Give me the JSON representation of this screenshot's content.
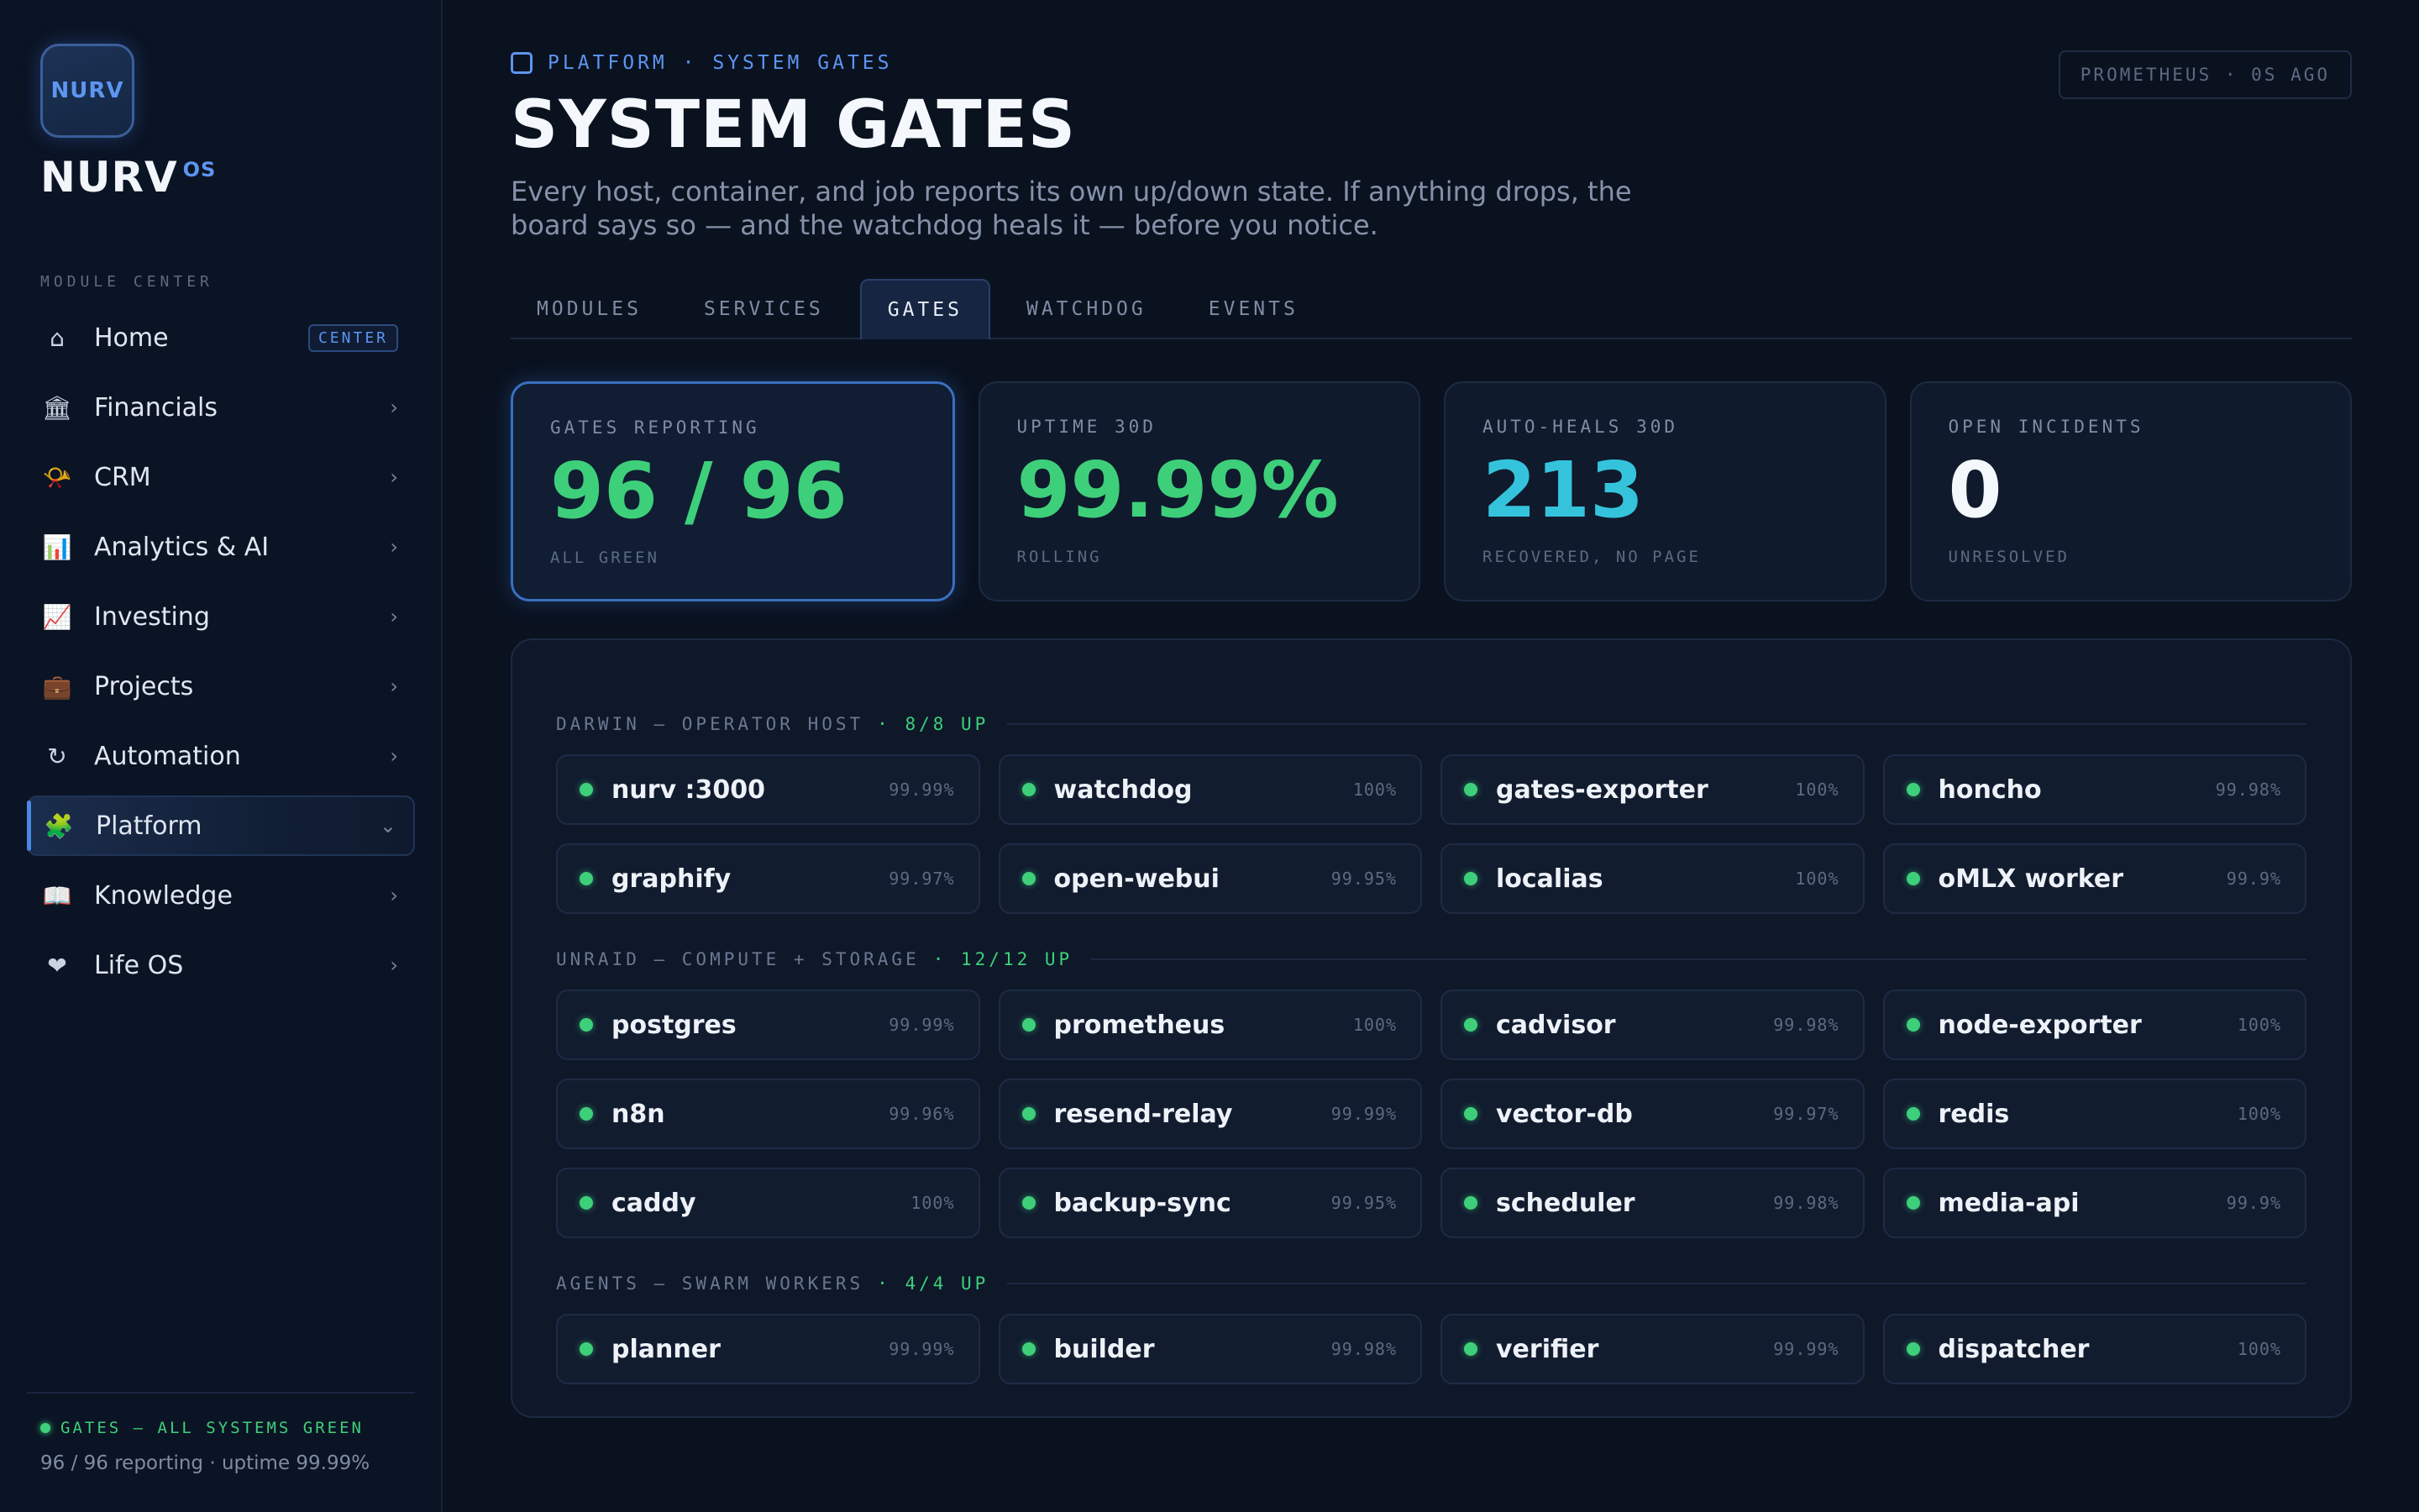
{
  "sidebar": {
    "logo_text": "NURV",
    "brand": "NURV",
    "brand_sup": "OS",
    "section_label": "MODULE CENTER",
    "items": [
      {
        "label": "Home",
        "icon": "⌂",
        "badge": "CENTER"
      },
      {
        "label": "Financials",
        "icon": "🏛",
        "chevron": "›"
      },
      {
        "label": "CRM",
        "icon": "📯",
        "chevron": "›"
      },
      {
        "label": "Analytics & AI",
        "icon": "📊",
        "chevron": "›"
      },
      {
        "label": "Investing",
        "icon": "📈",
        "chevron": "›"
      },
      {
        "label": "Projects",
        "icon": "💼",
        "chevron": "›"
      },
      {
        "label": "Automation",
        "icon": "↻",
        "chevron": "›"
      },
      {
        "label": "Platform",
        "icon": "🧩",
        "chevron": "⌄"
      },
      {
        "label": "Knowledge",
        "icon": "📖",
        "chevron": "›"
      },
      {
        "label": "Life OS",
        "icon": "❤",
        "chevron": "›"
      }
    ],
    "footer_status": "GATES — ALL SYSTEMS GREEN",
    "footer_detail": "96 / 96 reporting · uptime 99.99%"
  },
  "header": {
    "breadcrumb": "PLATFORM · SYSTEM GATES",
    "source_badge": "PROMETHEUS · 0S AGO",
    "title": "SYSTEM GATES",
    "subtitle": "Every host, container, and job reports its own up/down state. If anything drops, the board says so — and the watchdog heals it — before you notice."
  },
  "tabs": [
    "MODULES",
    "SERVICES",
    "GATES",
    "WATCHDOG",
    "EVENTS"
  ],
  "active_tab": "GATES",
  "stats": [
    {
      "label": "GATES REPORTING",
      "value": "96 / 96",
      "sub": "ALL GREEN"
    },
    {
      "label": "UPTIME 30D",
      "value": "99.99%",
      "sub": "ROLLING"
    },
    {
      "label": "AUTO-HEALS 30D",
      "value": "213",
      "sub": "RECOVERED, NO PAGE"
    },
    {
      "label": "OPEN INCIDENTS",
      "value": "0",
      "sub": "UNRESOLVED"
    }
  ],
  "groups": [
    {
      "title": "DARWIN — OPERATOR HOST",
      "up": "· 8/8 UP",
      "gates": [
        {
          "name": "nurv :3000",
          "pct": "99.99%"
        },
        {
          "name": "watchdog",
          "pct": "100%"
        },
        {
          "name": "gates-exporter",
          "pct": "100%"
        },
        {
          "name": "honcho",
          "pct": "99.98%"
        },
        {
          "name": "graphify",
          "pct": "99.97%"
        },
        {
          "name": "open-webui",
          "pct": "99.95%"
        },
        {
          "name": "localias",
          "pct": "100%"
        },
        {
          "name": "oMLX worker",
          "pct": "99.9%"
        }
      ]
    },
    {
      "title": "UNRAID — COMPUTE + STORAGE",
      "up": "· 12/12 UP",
      "gates": [
        {
          "name": "postgres",
          "pct": "99.99%"
        },
        {
          "name": "prometheus",
          "pct": "100%"
        },
        {
          "name": "cadvisor",
          "pct": "99.98%"
        },
        {
          "name": "node-exporter",
          "pct": "100%"
        },
        {
          "name": "n8n",
          "pct": "99.96%"
        },
        {
          "name": "resend-relay",
          "pct": "99.99%"
        },
        {
          "name": "vector-db",
          "pct": "99.97%"
        },
        {
          "name": "redis",
          "pct": "100%"
        },
        {
          "name": "caddy",
          "pct": "100%"
        },
        {
          "name": "backup-sync",
          "pct": "99.95%"
        },
        {
          "name": "scheduler",
          "pct": "99.98%"
        },
        {
          "name": "media-api",
          "pct": "99.9%"
        }
      ]
    },
    {
      "title": "AGENTS — SWARM WORKERS",
      "up": "· 4/4 UP",
      "gates": [
        {
          "name": "planner",
          "pct": "99.99%"
        },
        {
          "name": "builder",
          "pct": "99.98%"
        },
        {
          "name": "verifier",
          "pct": "99.99%"
        },
        {
          "name": "dispatcher",
          "pct": "100%"
        }
      ]
    }
  ],
  "colors": {
    "accent": "#4c86e6",
    "status_green": "#3ecf7a",
    "cyan": "#35c3dc",
    "background": "#0a1220"
  }
}
